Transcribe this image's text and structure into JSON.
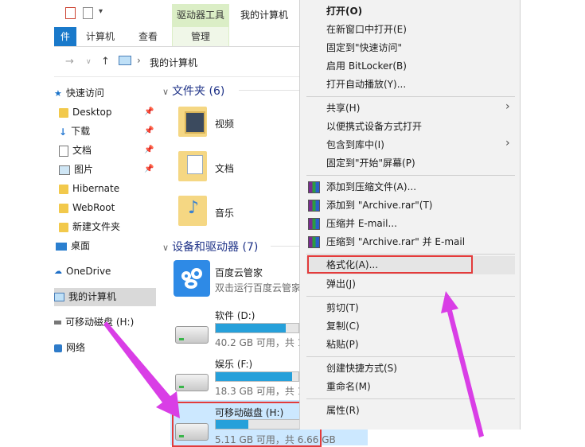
{
  "ribbon": {
    "context_tab": "驱动器工具",
    "window_title": "我的计算机",
    "tabs": [
      "件",
      "计算机",
      "查看"
    ],
    "manage_tab": "管理"
  },
  "address": {
    "path": "我的计算机"
  },
  "nav": {
    "quick_access": "快速访问",
    "items": [
      "Desktop",
      "下载",
      "文档",
      "图片",
      "Hibernate",
      "WebRoot",
      "新建文件夹",
      "桌面"
    ],
    "onedrive": "OneDrive",
    "this_pc": "我的计算机",
    "removable": "可移动磁盘 (H:)",
    "network": "网络"
  },
  "content": {
    "folders_header": "文件夹 (6)",
    "folders": [
      "视频",
      "文档",
      "音乐"
    ],
    "devices_header": "设备和驱动器 (7)",
    "baidu": {
      "name": "百度云管家",
      "sub": "双击运行百度云管家"
    },
    "drives": [
      {
        "name": "软件 (D:)",
        "free": "40.2 GB 可用，共 1",
        "used": 0.85
      },
      {
        "name": "娱乐 (F:)",
        "free": "18.3 GB 可用，共 1",
        "used": 0.92
      },
      {
        "name": "可移动磁盘 (H:)",
        "free": "5.11 GB 可用，共 6.66 GB",
        "used": 0.23
      }
    ]
  },
  "menu": {
    "open": "打开(O)",
    "open_new_window": "在新窗口中打开(E)",
    "pin_quick": "固定到\"快速访问\"",
    "bitlocker": "启用 BitLocker(B)",
    "autoplay": "打开自动播放(Y)...",
    "share": "共享(H)",
    "portable": "以便携式设备方式打开",
    "include_library": "包含到库中(I)",
    "pin_start": "固定到\"开始\"屏幕(P)",
    "add_archive": "添加到压缩文件(A)...",
    "add_rar": "添加到 \"Archive.rar\"(T)",
    "compress_email": "压缩并 E-mail...",
    "compress_rar_email": "压缩到 \"Archive.rar\" 并 E-mail",
    "format": "格式化(A)...",
    "eject": "弹出(J)",
    "cut": "剪切(T)",
    "copy": "复制(C)",
    "paste": "粘贴(P)",
    "shortcut": "创建快捷方式(S)",
    "rename": "重命名(M)",
    "properties": "属性(R)"
  },
  "colors": {
    "accent": "#1979ca",
    "highlight": "#e33b3b",
    "arrow": "#d93ee6",
    "context_tab": "#dbeec6"
  }
}
